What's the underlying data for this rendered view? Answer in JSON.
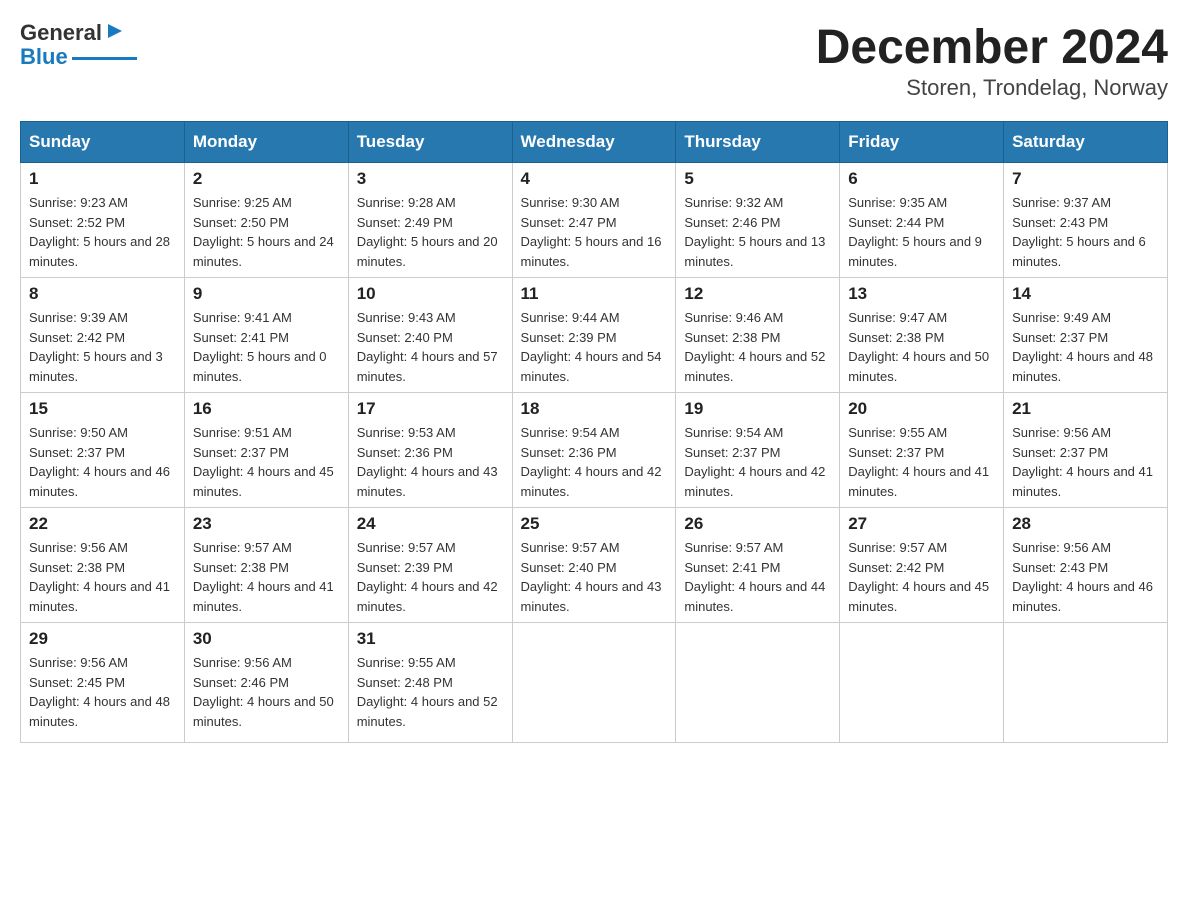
{
  "header": {
    "month_title": "December 2024",
    "location": "Storen, Trondelag, Norway",
    "logo_general": "General",
    "logo_blue": "Blue"
  },
  "weekdays": [
    "Sunday",
    "Monday",
    "Tuesday",
    "Wednesday",
    "Thursday",
    "Friday",
    "Saturday"
  ],
  "weeks": [
    [
      {
        "day": "1",
        "sunrise": "9:23 AM",
        "sunset": "2:52 PM",
        "daylight": "5 hours and 28 minutes."
      },
      {
        "day": "2",
        "sunrise": "9:25 AM",
        "sunset": "2:50 PM",
        "daylight": "5 hours and 24 minutes."
      },
      {
        "day": "3",
        "sunrise": "9:28 AM",
        "sunset": "2:49 PM",
        "daylight": "5 hours and 20 minutes."
      },
      {
        "day": "4",
        "sunrise": "9:30 AM",
        "sunset": "2:47 PM",
        "daylight": "5 hours and 16 minutes."
      },
      {
        "day": "5",
        "sunrise": "9:32 AM",
        "sunset": "2:46 PM",
        "daylight": "5 hours and 13 minutes."
      },
      {
        "day": "6",
        "sunrise": "9:35 AM",
        "sunset": "2:44 PM",
        "daylight": "5 hours and 9 minutes."
      },
      {
        "day": "7",
        "sunrise": "9:37 AM",
        "sunset": "2:43 PM",
        "daylight": "5 hours and 6 minutes."
      }
    ],
    [
      {
        "day": "8",
        "sunrise": "9:39 AM",
        "sunset": "2:42 PM",
        "daylight": "5 hours and 3 minutes."
      },
      {
        "day": "9",
        "sunrise": "9:41 AM",
        "sunset": "2:41 PM",
        "daylight": "5 hours and 0 minutes."
      },
      {
        "day": "10",
        "sunrise": "9:43 AM",
        "sunset": "2:40 PM",
        "daylight": "4 hours and 57 minutes."
      },
      {
        "day": "11",
        "sunrise": "9:44 AM",
        "sunset": "2:39 PM",
        "daylight": "4 hours and 54 minutes."
      },
      {
        "day": "12",
        "sunrise": "9:46 AM",
        "sunset": "2:38 PM",
        "daylight": "4 hours and 52 minutes."
      },
      {
        "day": "13",
        "sunrise": "9:47 AM",
        "sunset": "2:38 PM",
        "daylight": "4 hours and 50 minutes."
      },
      {
        "day": "14",
        "sunrise": "9:49 AM",
        "sunset": "2:37 PM",
        "daylight": "4 hours and 48 minutes."
      }
    ],
    [
      {
        "day": "15",
        "sunrise": "9:50 AM",
        "sunset": "2:37 PM",
        "daylight": "4 hours and 46 minutes."
      },
      {
        "day": "16",
        "sunrise": "9:51 AM",
        "sunset": "2:37 PM",
        "daylight": "4 hours and 45 minutes."
      },
      {
        "day": "17",
        "sunrise": "9:53 AM",
        "sunset": "2:36 PM",
        "daylight": "4 hours and 43 minutes."
      },
      {
        "day": "18",
        "sunrise": "9:54 AM",
        "sunset": "2:36 PM",
        "daylight": "4 hours and 42 minutes."
      },
      {
        "day": "19",
        "sunrise": "9:54 AM",
        "sunset": "2:37 PM",
        "daylight": "4 hours and 42 minutes."
      },
      {
        "day": "20",
        "sunrise": "9:55 AM",
        "sunset": "2:37 PM",
        "daylight": "4 hours and 41 minutes."
      },
      {
        "day": "21",
        "sunrise": "9:56 AM",
        "sunset": "2:37 PM",
        "daylight": "4 hours and 41 minutes."
      }
    ],
    [
      {
        "day": "22",
        "sunrise": "9:56 AM",
        "sunset": "2:38 PM",
        "daylight": "4 hours and 41 minutes."
      },
      {
        "day": "23",
        "sunrise": "9:57 AM",
        "sunset": "2:38 PM",
        "daylight": "4 hours and 41 minutes."
      },
      {
        "day": "24",
        "sunrise": "9:57 AM",
        "sunset": "2:39 PM",
        "daylight": "4 hours and 42 minutes."
      },
      {
        "day": "25",
        "sunrise": "9:57 AM",
        "sunset": "2:40 PM",
        "daylight": "4 hours and 43 minutes."
      },
      {
        "day": "26",
        "sunrise": "9:57 AM",
        "sunset": "2:41 PM",
        "daylight": "4 hours and 44 minutes."
      },
      {
        "day": "27",
        "sunrise": "9:57 AM",
        "sunset": "2:42 PM",
        "daylight": "4 hours and 45 minutes."
      },
      {
        "day": "28",
        "sunrise": "9:56 AM",
        "sunset": "2:43 PM",
        "daylight": "4 hours and 46 minutes."
      }
    ],
    [
      {
        "day": "29",
        "sunrise": "9:56 AM",
        "sunset": "2:45 PM",
        "daylight": "4 hours and 48 minutes."
      },
      {
        "day": "30",
        "sunrise": "9:56 AM",
        "sunset": "2:46 PM",
        "daylight": "4 hours and 50 minutes."
      },
      {
        "day": "31",
        "sunrise": "9:55 AM",
        "sunset": "2:48 PM",
        "daylight": "4 hours and 52 minutes."
      },
      null,
      null,
      null,
      null
    ]
  ]
}
